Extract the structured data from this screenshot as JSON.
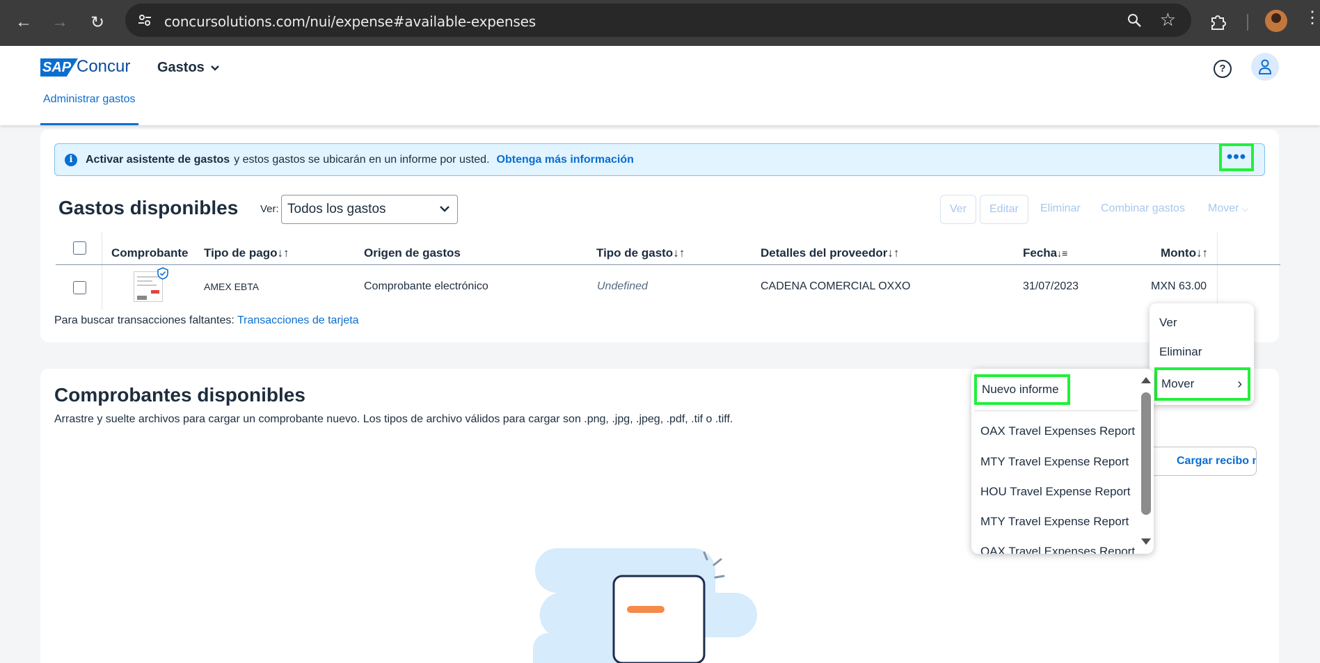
{
  "browser": {
    "url": "concursolutions.com/nui/expense#available-expenses"
  },
  "header": {
    "logo_sap": "SAP",
    "logo_concur": "Concur",
    "menu": "Gastos",
    "tab": "Administrar gastos"
  },
  "banner": {
    "bold": "Activar asistente de gastos",
    "text": "y estos gastos se ubicarán en un informe por usted.",
    "link": "Obtenga más información"
  },
  "expenses": {
    "title": "Gastos disponibles",
    "view_label": "Ver:",
    "view_value": "Todos los gastos",
    "toolbar": {
      "ver": "Ver",
      "editar": "Editar",
      "eliminar": "Eliminar",
      "combinar": "Combinar gastos",
      "mover": "Mover"
    },
    "columns": {
      "comprobante": "Comprobante",
      "tipo_pago": "Tipo de pago",
      "origen": "Origen de gastos",
      "tipo_gasto": "Tipo de gasto",
      "proveedor": "Detalles del proveedor",
      "fecha": "Fecha",
      "monto": "Monto"
    },
    "rows": [
      {
        "tipo_pago": "AMEX EBTA",
        "origen": "Comprobante electrónico",
        "tipo_gasto": "Undefined",
        "proveedor": "CADENA COMERCIAL OXXO",
        "fecha": "31/07/2023",
        "monto": "MXN 63.00"
      }
    ],
    "missing_text": "Para buscar transacciones faltantes:",
    "missing_link": "Transacciones de tarjeta"
  },
  "receipts": {
    "title": "Comprobantes disponibles",
    "description": "Arrastre y suelte archivos para cargar un comprobante nuevo. Los tipos de archivo válidos para cargar son .png, .jpg, .jpeg, .pdf, .tif o .tiff.",
    "upload": "Cargar recibo nuevo"
  },
  "context_menu": {
    "items": [
      "Ver",
      "Eliminar",
      "Mover"
    ]
  },
  "submenu": {
    "new": "Nuevo informe",
    "reports": [
      "OAX Travel Expenses Report",
      "MTY Travel Expense Report",
      "HOU Travel Expense Report",
      "MTY Travel Expense Report",
      "OAX Travel Expenses Report"
    ]
  },
  "colors": {
    "accent": "#0a6ed1",
    "highlight": "#22f03a",
    "banner_bg": "#e1f4ff"
  }
}
